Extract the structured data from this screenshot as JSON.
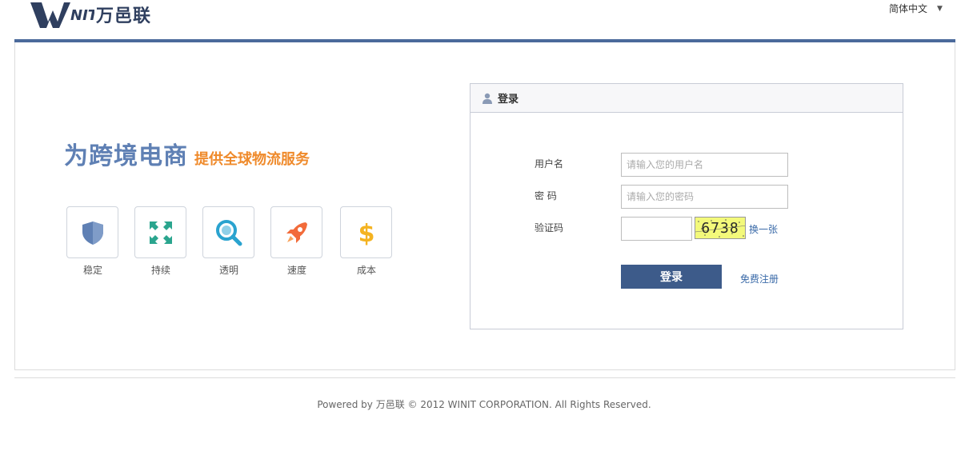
{
  "header": {
    "logo_text": "WINIT",
    "logo_cn": "万邑联",
    "language": "简体中文"
  },
  "hero": {
    "slogan_main": "为跨境电商",
    "slogan_sub": "提供全球物流服务"
  },
  "features": [
    {
      "label": "稳定",
      "icon": "shield-icon",
      "color": "#5f80b4"
    },
    {
      "label": "持续",
      "icon": "arrows-icon",
      "color": "#2aa58e"
    },
    {
      "label": "透明",
      "icon": "magnifier-icon",
      "color": "#2aa3cf"
    },
    {
      "label": "速度",
      "icon": "rocket-icon",
      "color": "#f26b3a"
    },
    {
      "label": "成本",
      "icon": "dollar-icon",
      "color": "#f4b321"
    }
  ],
  "login": {
    "title": "登录",
    "username_label": "用户名",
    "username_placeholder": "请输入您的用户名",
    "password_label": "密 码",
    "password_placeholder": "请输入您的密码",
    "captcha_label": "验证码",
    "captcha_value": "",
    "captcha_text": "6738",
    "refresh_label": "换一张",
    "submit_label": "登录",
    "register_label": "免费注册"
  },
  "footer": {
    "copyright": "Powered by 万邑联 © 2012 WINIT CORPORATION. All Rights Reserved."
  },
  "colors": {
    "brand_blue": "#4b6a9b",
    "button_blue": "#3d5b8a",
    "accent_orange": "#ef8a2b",
    "slogan_blue": "#5f80b4",
    "link_blue": "#3a6aa8"
  }
}
